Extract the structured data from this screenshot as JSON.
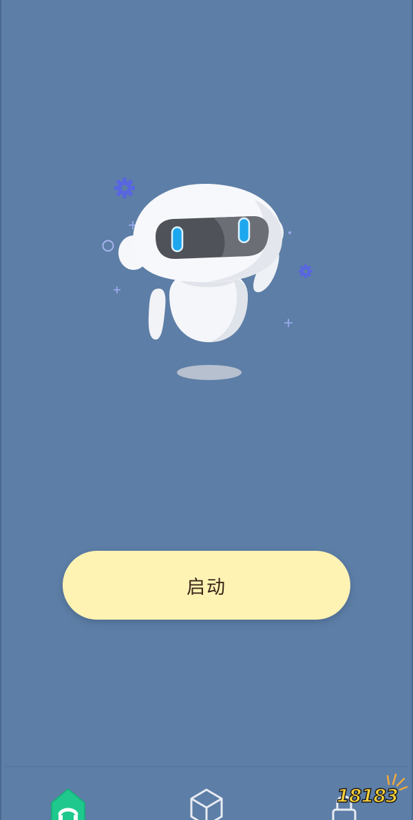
{
  "main": {
    "start_button_label": "启动"
  },
  "hero": {
    "icon": "robot-mascot-illustration"
  },
  "tabbar": {
    "tabs": [
      {
        "icon": "home-icon",
        "active": true
      },
      {
        "icon": "box-icon",
        "active": false
      },
      {
        "icon": "lock-icon",
        "active": false
      }
    ]
  },
  "watermark": {
    "text": "18183"
  },
  "colors": {
    "background": "#5d7ea6",
    "button": "#fff3b3",
    "button_text": "#3a2418",
    "active_tab": "#1fc98e",
    "decor": "#5866e0"
  }
}
